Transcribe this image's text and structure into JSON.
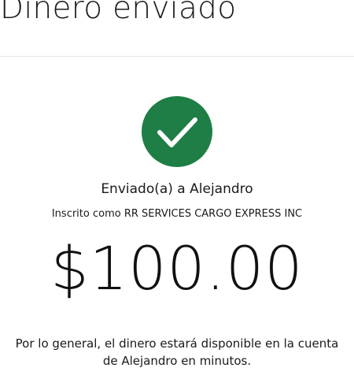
{
  "header": {
    "title": "Dinero enviado"
  },
  "status": {
    "icon": "checkmark-icon",
    "color": "#1e7e45"
  },
  "recipient": {
    "sent_to": "Enviado(a) a Alejandro",
    "enrolled_as": "Inscrito como RR SERVICES CARGO EXPRESS INC"
  },
  "transfer": {
    "amount": "$100.00"
  },
  "notice": {
    "line1": "Por lo general, el dinero estará disponible en la cuenta",
    "line2": "de Alejandro en minutos."
  }
}
